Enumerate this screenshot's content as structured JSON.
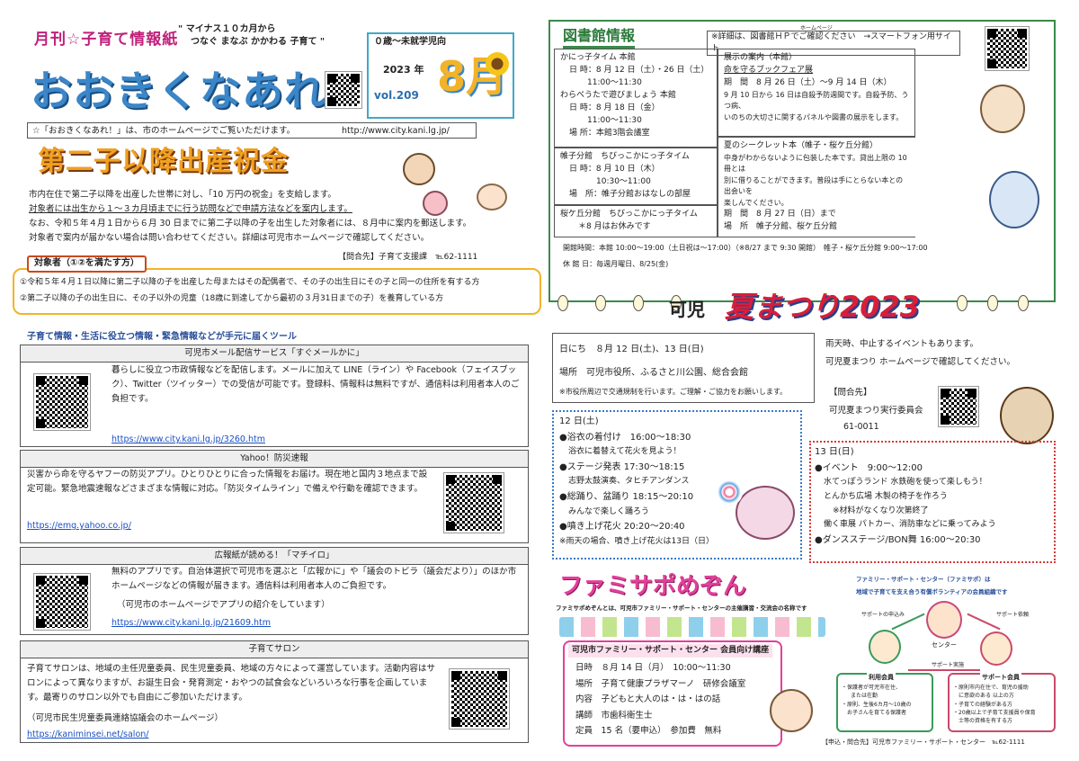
{
  "masthead": {
    "kicker": "月刊☆子育て情報紙",
    "slogan1": "\" マイナス１０カ月から",
    "slogan2": "つなぐ まなぶ かかわる 子育て \"",
    "title": "おおきくなあれ！",
    "age": "０歳～未就学児向",
    "year": "2023 年",
    "vol": "vol.209",
    "month": "8月",
    "web_note": "☆「おおきくなあれ！」は、市のホームページでご覧いただけます。",
    "web_url": "http://www.city.kani.lg.jp/"
  },
  "celebration": {
    "title": "第二子以降出産祝金",
    "line1": "市内在住で第二子以降を出産した世帯に対し、「10 万円の祝金」を支給します。",
    "line2": "対象者には出生から１～３カ月頃までに行う訪問などで申請方法などを案内します。",
    "line3": "なお、令和５年４月１日から６月 30 日までに第二子以降の子を出生した対象者には、８月中に案内を郵送します。",
    "line4": "対象者で案内が届かない場合は問い合わせてください。詳細は可児市ホームページで確認してください。",
    "contact": "【問合先】子育て支援課　℡62-1111",
    "target_label": "対象者（①②を満たす方）",
    "cond1": "①令和５年４月１日以降に第二子以降の子を出産した母またはその配偶者で、その子の出生日にその子と同一の住所を有する方",
    "cond2": "②第二子以降の子の出生日に、その子以外の児童（18歳に到達してから最初の３月31日までの子）を養育している方"
  },
  "tools": {
    "heading": "子育て情報・生活に役立つ情報・緊急情報などが手元に届くツール",
    "items": [
      {
        "title": "可児市メール配信サービス「すぐメールかに」",
        "body": "暮らしに役立つ市政情報などを配信します。メールに加えて LINE（ライン）や Facebook（フェイスブック）、Twitter（ツイッター）での受信が可能です。登録料、情報料は無料ですが、通信料は利用者本人のご負担です。",
        "url": "https://www.city.kani.lg.jp/3260.htm"
      },
      {
        "title": "Yahoo！防災速報",
        "body": "災害から命を守るヤフーの防災アプリ。ひとりひとりに合った情報をお届け。現在地と国内３地点まで設定可能。緊急地震速報などさまざまな情報に対応。「防災タイムライン」で備えや行動を確認できます。",
        "url": "https://emg.yahoo.co.jp/"
      },
      {
        "title": "広報紙が読める！「マチイロ」",
        "body": "無料のアプリです。自治体選択で可児市を選ぶと「広報かに」や「議会のトビラ（議会だより）」のほか市ホームページなどの情報が届きます。通信料は利用者本人のご負担です。",
        "body2": "（可児市のホームページでアプリの紹介をしています）",
        "url": "https://www.city.kani.lg.jp/21609.htm"
      },
      {
        "title": "子育てサロン",
        "body": "子育てサロンは、地域の主任児童委員、民生児童委員、地域の方々によって運営しています。活動内容はサロンによって異なりますが、お誕生日会・発育測定・おやつの試食会などいろいろな行事を企画しています。最寄りのサロン以外でも自由にご参加いただけます。",
        "body2": "（可児市民生児童委員連絡協議会のホームページ）",
        "url": "https://kaniminsei.net/salon/"
      }
    ]
  },
  "library": {
    "title": "図書館情報",
    "note": "※詳細は、図書館ＨＰでご確認ください　→スマートフォン用サイト",
    "hp_small": "ホームページ",
    "c1": [
      "かにっ子タイム 本館",
      "日 時：8 月 12 日（土）・26 日（土）",
      "11:00～11:30",
      "わらべうたで遊びましょう 本館",
      "日 時：8 月 18 日（金）",
      "11:00～11:30",
      "場 所：本館3階会議室"
    ],
    "c2": [
      "帷子分館　ちびっこかにっ子タイム",
      "日 時：8 月 10 日（木）",
      "10:30～11:00",
      "場　所：帷子分館おはなしの部屋"
    ],
    "c3": [
      "桜ケ丘分館　ちびっこかにっ子タイム",
      "＊8 月はお休みです"
    ],
    "d1": [
      "展示の案内（本館）",
      "命を守るブックフェア展",
      "期　間　8 月 26 日（土）～9 月 14 日（木）",
      "9 月 10 日から 16 日は自殺予防週間です。自殺予防、うつ病、",
      "いのちの大切さに関するパネルや図書の展示をします。"
    ],
    "d2": [
      "夏のシークレット本（帷子・桜ケ丘分館）",
      "中身がわからないように包装した本です。貸出上限の 10 冊とは",
      "別に借りることができます。普段は手にとらない本との出会いを",
      "楽しんでください。",
      "期　間　8 月 27 日（日）まで",
      "場　所　帷子分館、桜ケ丘分館"
    ],
    "hours": "開館時間：本館 10:00～19:00（土日祝は～17:00）（※8/27 まで 9:30 開館）　帷子・桜ケ丘分館 9:00～17:00",
    "closed": "休 館 日：毎週月曜日、8/25(金)"
  },
  "festival": {
    "prefix": "可児",
    "title": "夏まつり2023",
    "date": "日にち　８月 12 日(土)、13 日(日)",
    "place": "場所　可児市役所、ふるさと川公園、総合会館",
    "traffic": "※市役所周辺で交通規制を行います。ご理解・ご協力をお願いします。",
    "rain1": "雨天時、中止するイベントもあります。",
    "rain2": "可児夏まつり ホームページで確認してください。",
    "contact_label": "【問合先】",
    "contact_org": "可児夏まつり実行委員会",
    "contact_tel": "61-0011",
    "day12": [
      "12 日(土)",
      "●浴衣の着付け　16:00～18:30",
      "浴衣に着替えて花火を見よう！",
      "●ステージ発表 17:30～18:15",
      "志野太鼓演奏、タヒチアンダンス",
      "●総踊り、盆踊り 18:15～20:10",
      "みんなで楽しく踊ろう",
      "●噴き上げ花火 20:20～20:40",
      "※雨天の場合、噴き上げ花火は13日（日）"
    ],
    "day13": [
      "13 日(日)",
      "●イベント　9:00～12:00",
      "水てっぽうランド 水鉄砲を使って楽しもう！",
      "とんかち広場 木製の椅子を作ろう",
      "※材料がなくなり次第終了",
      "働く車展 パトカー、消防車などに乗ってみよう",
      "●ダンスステージ/BON舞 16:00～20:30"
    ]
  },
  "famisapo": {
    "title": "ファミサポめぞん",
    "desc": "ファミサポめぞんとは、可児市ファミリー・サポート・センターの主催講習・交流会の名称です",
    "course_title": "可児市ファミリー・サポート・センター 会員向け講座",
    "rows": [
      "日時　８月 14 日（月）　10:00～11:30",
      "場所　子育て健康プラザマーノ　研修会議室",
      "内容　子どもと大人のは・は・はの話",
      "講師　市歯科衛生士",
      "定員　15 名（要申込）　参加費　無料"
    ],
    "diagram_title1": "ファミリー・サポート・センター（ファミサポ）は",
    "diagram_title2": "地域で子育てを支え合う有償ボランティアの会員組織です",
    "center": "センター",
    "request": "サポートの申込み",
    "dispatch": "サポート依頼",
    "done": "サポート実施",
    "user_title": "利用会員",
    "user_lines": [
      "・保護者が可児市在住、",
      "または在勤",
      "・原則、生後6カ月～10歳の",
      "お子さんを育てる保護者"
    ],
    "support_title": "サポート会員",
    "support_lines": [
      "・原則市内在住で、育児の援助",
      "に意欲のある 以上の方",
      "・子育ての経験がある方",
      "・20歳以上で子育て支援員や保育",
      "士等の資格を有する方"
    ],
    "contact": "【申込・問合先】可児市ファミリー・サポート・センター　℡62-1111"
  }
}
